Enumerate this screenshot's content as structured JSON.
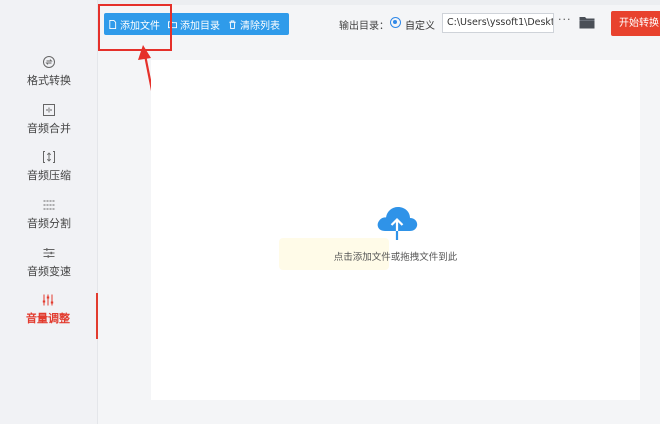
{
  "toolbar": {
    "add_file": "添加文件",
    "add_folder": "添加目录",
    "clear_list": "清除列表",
    "output_label": "输出目录：",
    "output_option": "自定义",
    "output_path": "C:\\Users\\yssoft1\\Deskt",
    "more": "···",
    "start": "开始转换"
  },
  "sidebar": {
    "items": [
      {
        "label": "格式转换",
        "icon": "format-convert-icon"
      },
      {
        "label": "音频合并",
        "icon": "audio-merge-icon"
      },
      {
        "label": "音频压缩",
        "icon": "audio-compress-icon"
      },
      {
        "label": "音频分割",
        "icon": "audio-split-icon"
      },
      {
        "label": "音频变速",
        "icon": "audio-speed-icon"
      },
      {
        "label": "音量调整",
        "icon": "volume-adjust-icon",
        "active": true
      }
    ]
  },
  "drop": {
    "hint": "点击添加文件或拖拽文件到此"
  },
  "colors": {
    "primary": "#2f9bea",
    "accent": "#e23b2e",
    "start_button": "#e8422e",
    "annotation": "#e5302a"
  }
}
